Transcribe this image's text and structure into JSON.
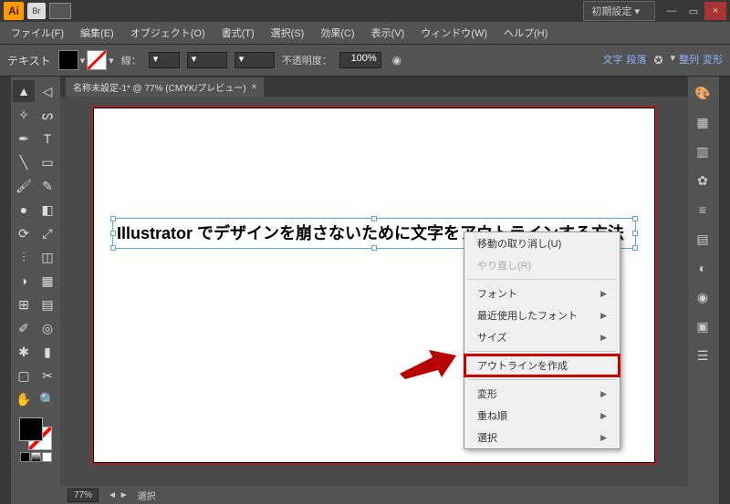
{
  "titlebar": {
    "logo": "Ai",
    "bridge": "Br",
    "workspace": "初期設定",
    "minimize": "—",
    "restore": "▭",
    "close": "×"
  },
  "menu": {
    "file": "ファイル(F)",
    "edit": "編集(E)",
    "object": "オブジェクト(O)",
    "type": "書式(T)",
    "select": "選択(S)",
    "effect": "効果(C)",
    "view": "表示(V)",
    "window": "ウィンドウ(W)",
    "help": "ヘルプ(H)"
  },
  "control": {
    "mode": "テキスト",
    "stroke_label": "線：",
    "stroke_dropdown": "▾",
    "dash_dropdown": "▾",
    "align_dropdown": "▾",
    "opacity_label": "不透明度：",
    "opacity_value": "100%",
    "char_panel": "文字",
    "para_panel": "段落",
    "align_panel": "整列",
    "transform_panel": "変形"
  },
  "document": {
    "tab_title": "名称未設定-1* @ 77% (CMYK/プレビュー)",
    "tab_close": "×",
    "text_content": "Illustrator でデザインを崩さないために文字をアウトラインする方法"
  },
  "status": {
    "zoom": "77%",
    "nav_arrows": "◄ ►",
    "info": "選択"
  },
  "context_menu": {
    "undo_move": "移動の取り消し(U)",
    "redo": "やり直し(R)",
    "font": "フォント",
    "recent_fonts": "最近使用したフォント",
    "size": "サイズ",
    "create_outlines": "アウトラインを作成",
    "transform": "変形",
    "arrange": "重ね順",
    "select": "選択"
  }
}
